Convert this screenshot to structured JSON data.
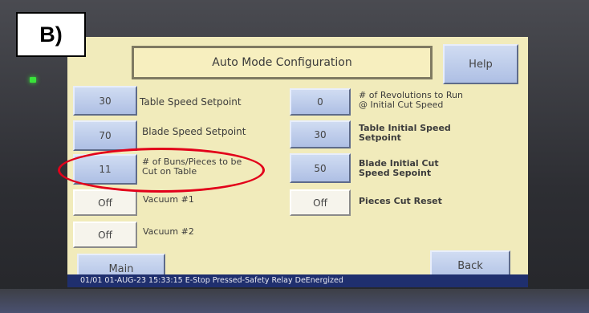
{
  "figure_tag": "B)",
  "screen": {
    "title": "Auto Mode Configuration",
    "help_label": "Help",
    "main_label": "Main",
    "back_label": "Back"
  },
  "left_rows": [
    {
      "value": "30",
      "label": "Table Speed Setpoint"
    },
    {
      "value": "70",
      "label": "Blade Speed Setpoint"
    },
    {
      "value": "11",
      "label_line1": "# of Buns/Pieces to be",
      "label_line2": "Cut on Table"
    },
    {
      "value": "Off",
      "label": "Vacuum #1"
    },
    {
      "value": "Off",
      "label": "Vacuum #2"
    }
  ],
  "right_rows": [
    {
      "value": "0",
      "label_line1": "# of Revolutions to Run",
      "label_line2": "@ Initial Cut Speed"
    },
    {
      "value": "30",
      "label_line1": "Table Initial Speed",
      "label_line2": "Setpoint"
    },
    {
      "value": "50",
      "label_line1": "Blade Initial Cut",
      "label_line2": "Speed Sepoint"
    },
    {
      "value": "Off",
      "label": "Pieces Cut Reset"
    }
  ],
  "status_bar": {
    "text": "01/01 01-AUG-23 15:33:15 E-Stop Pressed-Safety Relay DeEnergized"
  },
  "colors": {
    "screen_bg": "#f1ebbb",
    "button_blue": "#aebfe4",
    "status_bar": "#1f2f6e",
    "highlight": "#e2001a",
    "led": "#39e33a"
  }
}
